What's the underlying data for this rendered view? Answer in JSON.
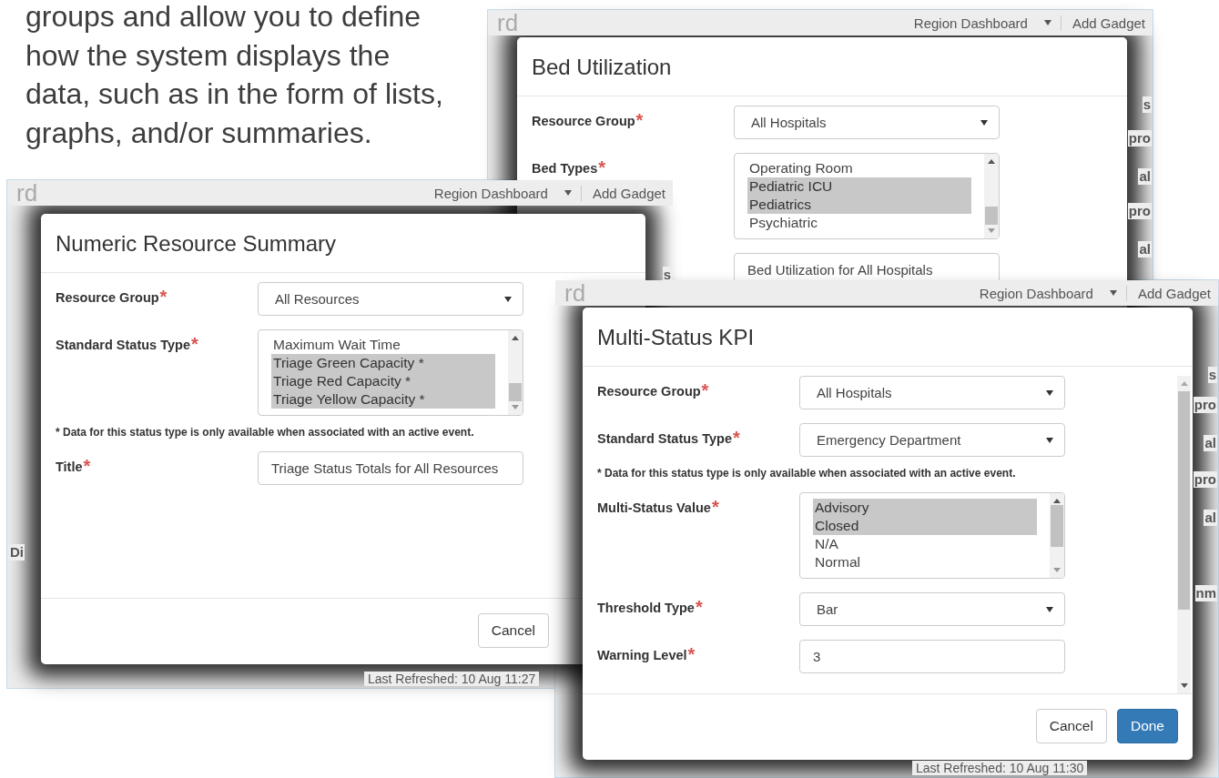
{
  "intro": "groups and allow you to define how the system displays the data, such as in the form of lists, graphs, and/or summaries.",
  "screenshots": [
    {
      "dashboard": {
        "title_fragment": "rd",
        "menu": "Region Dashboard",
        "add_button": "Add Gadget",
        "side_fragments": [
          "s",
          "pro",
          "al",
          "pro",
          "al"
        ]
      },
      "dialog": {
        "title": "Bed Utilization",
        "fields": [
          {
            "kind": "select",
            "label": "Resource Group",
            "required_mark": "*",
            "value": "All Hospitals"
          },
          {
            "kind": "listbox",
            "label": "Bed Types",
            "required_mark": "*",
            "options": [
              {
                "label": "Operating Room",
                "selected": false
              },
              {
                "label": "Pediatric ICU",
                "selected": true
              },
              {
                "label": "Pediatrics",
                "selected": true
              },
              {
                "label": "Psychiatric",
                "selected": false
              }
            ]
          },
          {
            "kind": "input",
            "value": "Bed Utilization for All Hospitals"
          }
        ]
      }
    },
    {
      "dashboard": {
        "title_fragment": "rd",
        "menu": "Region Dashboard",
        "add_button": "Add Gadget",
        "side_fragments": [
          "s",
          "Di"
        ],
        "refreshed": "Last Refreshed: 10 Aug 11:27"
      },
      "dialog": {
        "title": "Numeric Resource Summary",
        "fields": [
          {
            "kind": "select",
            "label": "Resource Group",
            "required_mark": "*",
            "value": "All Resources"
          },
          {
            "kind": "listbox",
            "label": "Standard Status Type",
            "required_mark": "*",
            "options": [
              {
                "label": "Maximum Wait Time",
                "selected": false
              },
              {
                "label": "Triage Green Capacity *",
                "selected": true
              },
              {
                "label": "Triage Red Capacity *",
                "selected": true
              },
              {
                "label": "Triage Yellow Capacity *",
                "selected": true
              }
            ]
          },
          {
            "kind": "note",
            "text": "* Data for this status type is only available when associated with an active event."
          },
          {
            "kind": "input",
            "label": "Title",
            "required_mark": "*",
            "value": "Triage Status Totals for All Resources"
          }
        ],
        "buttons": [
          {
            "label": "Cancel",
            "kind": "default"
          }
        ]
      }
    },
    {
      "dashboard": {
        "title_fragment": "rd",
        "menu": "Region Dashboard",
        "add_button": "Add Gadget",
        "side_fragments": [
          "s",
          "pro",
          "al",
          "pro",
          "al",
          "nm"
        ],
        "refreshed": "Last Refreshed: 10 Aug 11:30"
      },
      "dialog": {
        "title": "Multi-Status KPI",
        "scrollable": true,
        "fields": [
          {
            "kind": "select",
            "label": "Resource Group",
            "required_mark": "*",
            "value": "All Hospitals"
          },
          {
            "kind": "select",
            "label": "Standard Status Type",
            "required_mark": "*",
            "value": "Emergency Department"
          },
          {
            "kind": "note",
            "text": "* Data for this status type is only available when associated with an active event."
          },
          {
            "kind": "listbox",
            "label": "Multi-Status Value",
            "required_mark": "*",
            "options": [
              {
                "label": "Advisory",
                "selected": true
              },
              {
                "label": "Closed",
                "selected": true
              },
              {
                "label": "N/A",
                "selected": false
              },
              {
                "label": "Normal",
                "selected": false
              }
            ]
          },
          {
            "kind": "select",
            "label": "Threshold Type",
            "required_mark": "*",
            "value": "Bar"
          },
          {
            "kind": "input",
            "label": "Warning Level",
            "required_mark": "*",
            "value": "3"
          }
        ],
        "buttons": [
          {
            "label": "Cancel",
            "kind": "default"
          },
          {
            "label": "Done",
            "kind": "primary"
          }
        ]
      }
    }
  ]
}
